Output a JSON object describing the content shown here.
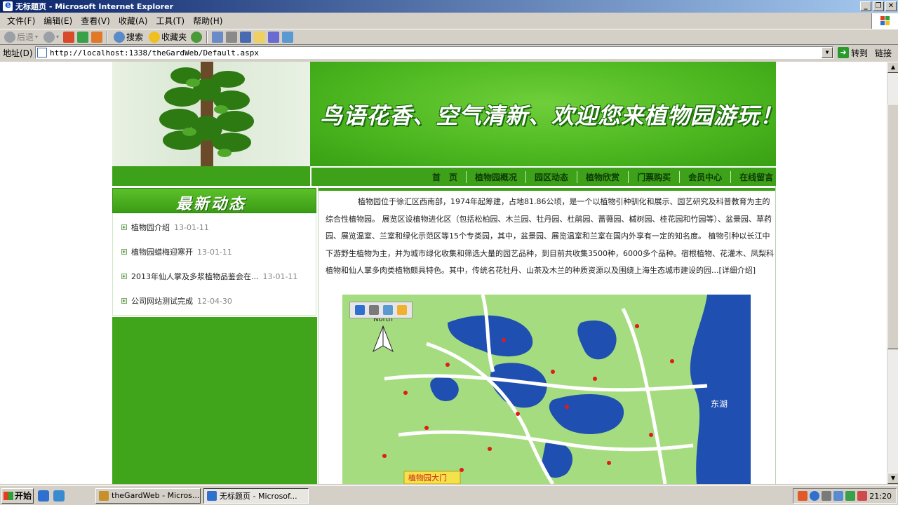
{
  "window": {
    "title": "无标题页 - Microsoft Internet Explorer",
    "buttons": [
      "_",
      "❐",
      "✕"
    ]
  },
  "menu": [
    "文件(F)",
    "编辑(E)",
    "查看(V)",
    "收藏(A)",
    "工具(T)",
    "帮助(H)"
  ],
  "toolbar": {
    "back": "后退",
    "search": "搜索",
    "favorites": "收藏夹"
  },
  "address": {
    "label": "地址(D)",
    "url": "http://localhost:1338/theGardWeb/Default.aspx",
    "go": "转到",
    "links": "链接"
  },
  "banner": {
    "slogan": "鸟语花香、空气清新、欢迎您来植物园游玩！！"
  },
  "nav": [
    "首　页",
    "植物园概况",
    "园区动态",
    "植物欣赏",
    "门票购买",
    "会员中心",
    "在线留言"
  ],
  "news": {
    "title": "最新动态",
    "items": [
      {
        "title": "植物园介绍",
        "date": "13-01-11"
      },
      {
        "title": "植物园蜡梅迎寒开",
        "date": "13-01-11"
      },
      {
        "title": "2013年仙人掌及多浆植物品鉴会在...",
        "date": "13-01-11"
      },
      {
        "title": "公司网站测试完成",
        "date": "12-04-30"
      }
    ]
  },
  "intro": "植物园位于徐汇区西南部，1974年起筹建，占地81.86公顷，是一个以植物引种驯化和展示、园艺研究及科普教育为主的综合性植物园。 展览区设植物进化区（包括松柏园、木兰园、牡丹园、杜鹃园、蔷薇园、槭树园、桂花园和竹园等）、盆景园、草药园、展览温室、兰室和绿化示范区等15个专类园，其中，盆景园、展览温室和兰室在国内外享有一定的知名度。 植物引种以长江中下游野生植物为主，并为城市绿化收集和筛选大量的园艺品种，到目前共收集3500种，6000多个品种。宿根植物、花灌木、凤梨科植物和仙人掌多肉类植物颇具特色。其中，传统名花牡丹、山茶及木兰的种质资源以及围绕上海生态城市建设的园...[详细介绍]",
  "map": {
    "labels": [
      "North",
      "东湖",
      "植物园大门"
    ]
  },
  "taskbar": {
    "start": "开始",
    "tasks": [
      "theGardWeb - Micros...",
      "无标题页 - Microsof..."
    ],
    "clock": "21:20"
  }
}
